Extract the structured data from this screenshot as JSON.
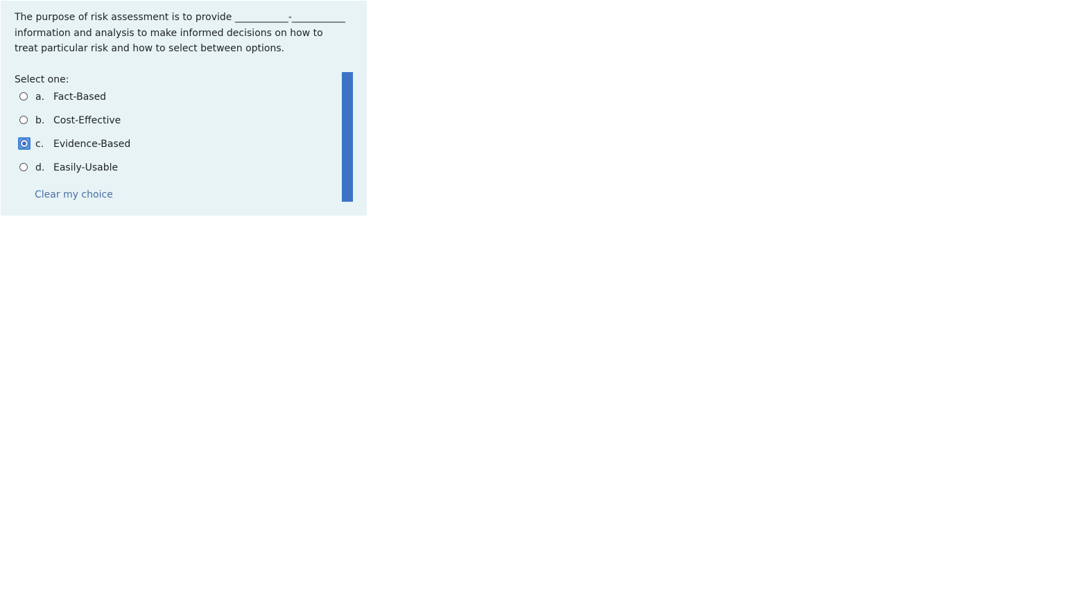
{
  "question": {
    "text": "The purpose of risk assessment is to provide ___________-___________ information and analysis to make informed decisions on how to treat particular risk and how to select between options.",
    "prompt": "Select one:"
  },
  "answers": [
    {
      "letter": "a.",
      "label": "Fact-Based",
      "selected": false
    },
    {
      "letter": "b.",
      "label": "Cost-Effective",
      "selected": false
    },
    {
      "letter": "c.",
      "label": "Evidence-Based",
      "selected": true
    },
    {
      "letter": "d.",
      "label": "Easily-Usable",
      "selected": false
    }
  ],
  "clear_label": "Clear my choice",
  "colors": {
    "card_background": "#e7f3f5",
    "link": "#4a6fa6",
    "selection_highlight": "#3d73c7"
  }
}
